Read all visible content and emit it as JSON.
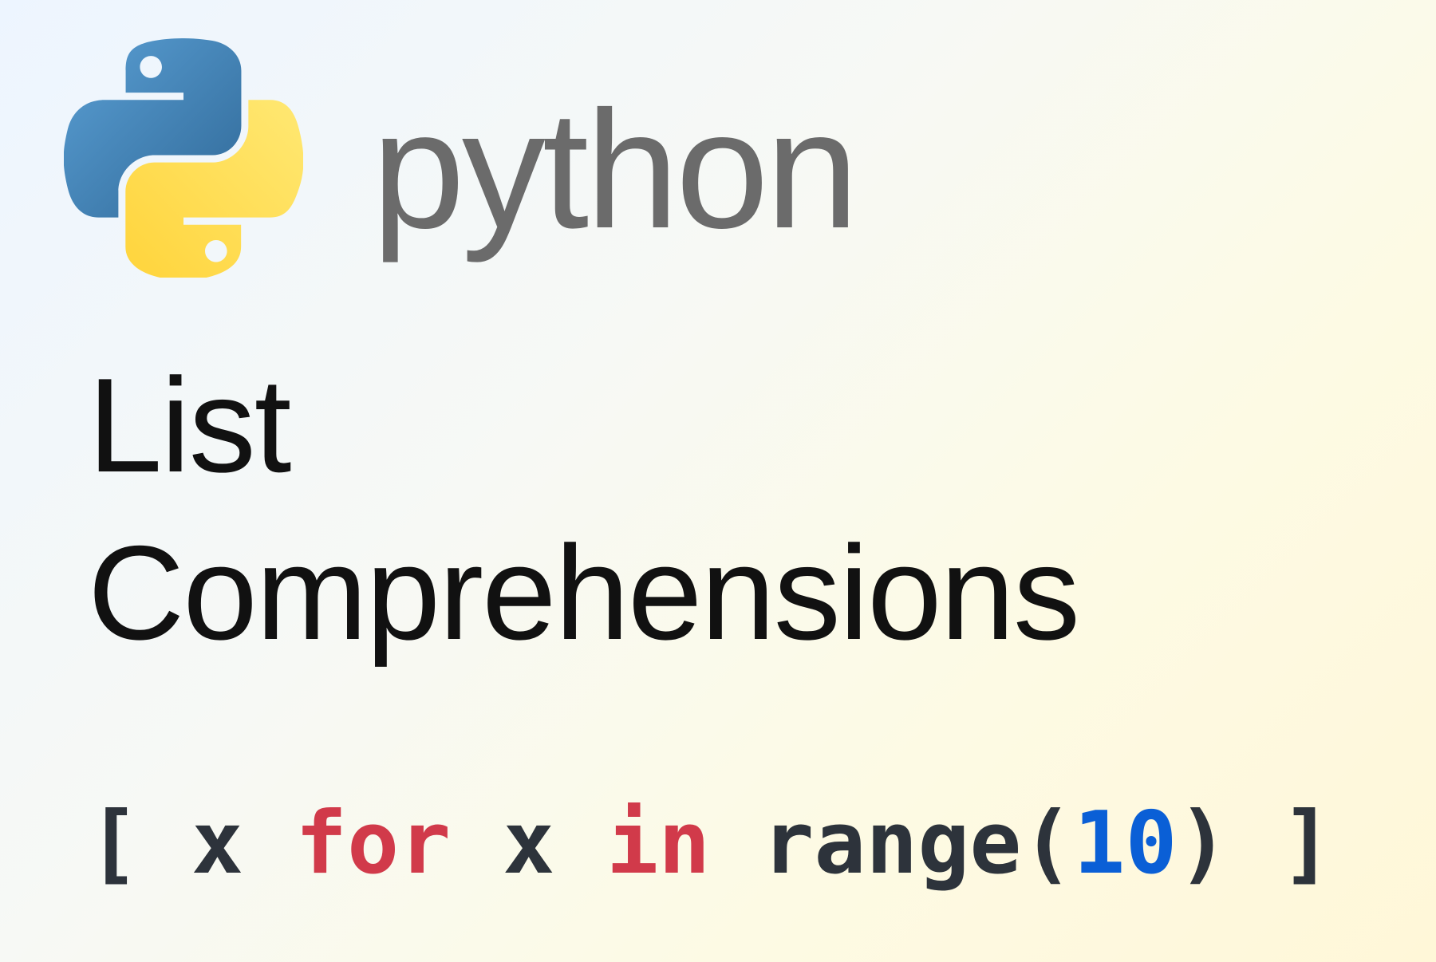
{
  "header": {
    "logo_alt": "python-logo",
    "wordmark": "python"
  },
  "heading": {
    "line1": "List",
    "line2": "Comprehensions"
  },
  "code": {
    "open_bracket": "[ ",
    "var1": "x ",
    "kw_for": "for",
    "sp1": " ",
    "var2": "x ",
    "kw_in": "in",
    "sp2": " ",
    "func": "range",
    "lparen": "(",
    "number": "10",
    "rparen": ")",
    "close_bracket": " ]"
  },
  "colors": {
    "keyword": "#d13a4a",
    "number": "#0a5fd6",
    "text": "#2d333b",
    "wordmark": "#6b6b6b",
    "python_blue": "#3776ab",
    "python_yellow": "#ffd43b"
  }
}
